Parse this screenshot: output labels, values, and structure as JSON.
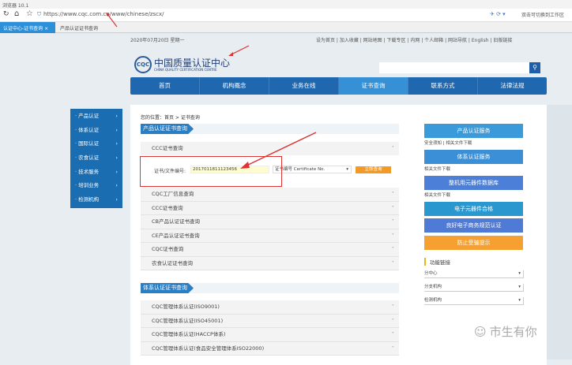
{
  "browser": {
    "title": "浏览器 10.1",
    "url": "https://www.cqc.com.cn/www/chinese/zscx/",
    "ext_text": "双击可切换到工作区",
    "tabs": [
      {
        "label": "认证中心-证书查询",
        "active": true
      },
      {
        "label": "产品认证证书查询",
        "active": false
      }
    ]
  },
  "topbar": {
    "date": "2020年07月20日 星期一",
    "links": "设为首页 | 加入收藏 | 网站地图 | 下载专区 | 内网 | 个人邮箱 | 网站导航 | English | 旧版链接"
  },
  "logo": {
    "seal": "CQC",
    "name": "中国质量认证中心",
    "name_en": "CHINA QUALITY CERTIFICATION CENTRE"
  },
  "nav": [
    "首页",
    "机构概念",
    "业务在线",
    "证书查询",
    "联系方式",
    "法律法规"
  ],
  "nav_active": 3,
  "sidebar": [
    "产品认证",
    "体系认证",
    "国际认证",
    "农食认证",
    "技术服务",
    "培训业务",
    "检测机构"
  ],
  "breadcrumb": "您的位置：首页 > 证书查询",
  "product_section": {
    "title": "产品认证证书查询",
    "expanded": {
      "title": "CCC证书查询",
      "label": "证书/文件编号:",
      "value": "2017011811123456",
      "select": "证书编号 Certificate No.",
      "button": "立即查询"
    },
    "rows": [
      "CQC工厂信息查询",
      "CCC证书查询",
      "CB产品认证证书查询",
      "CE产品认证证书查询",
      "CQC证书查询",
      "农食认证证书查询"
    ]
  },
  "system_section": {
    "title": "体系认证证书查询",
    "rows": [
      "CQC管理体系认证(ISO9001)",
      "CQC管理体系认证(ISO45001)",
      "CQC管理体系认证(HACCP体系)",
      "CQC管理体系认证(食品安全管理体系ISO22000)"
    ]
  },
  "right": {
    "buttons": [
      {
        "label": "产品认证服务",
        "color": "#3b9ad9"
      },
      {
        "label": "体系认证服务",
        "color": "#3b8fd6"
      },
      {
        "label": "整机用元器件数据库",
        "color": "#4b7fd8"
      },
      {
        "label": "电子元器件合格",
        "color": "#2b97cf"
      },
      {
        "label": "良好电子商务规范认证",
        "color": "#4f7ad6"
      },
      {
        "label": "防止受骗提示",
        "color": "#f5a030"
      }
    ],
    "labels": [
      "安全须知 | 相关文件下载",
      "相关文件下载",
      "相关文件下载"
    ],
    "func_title": "功能链接",
    "selects": [
      "分中心",
      "分支机构",
      "检测机构"
    ]
  },
  "watermark": "市生有你"
}
